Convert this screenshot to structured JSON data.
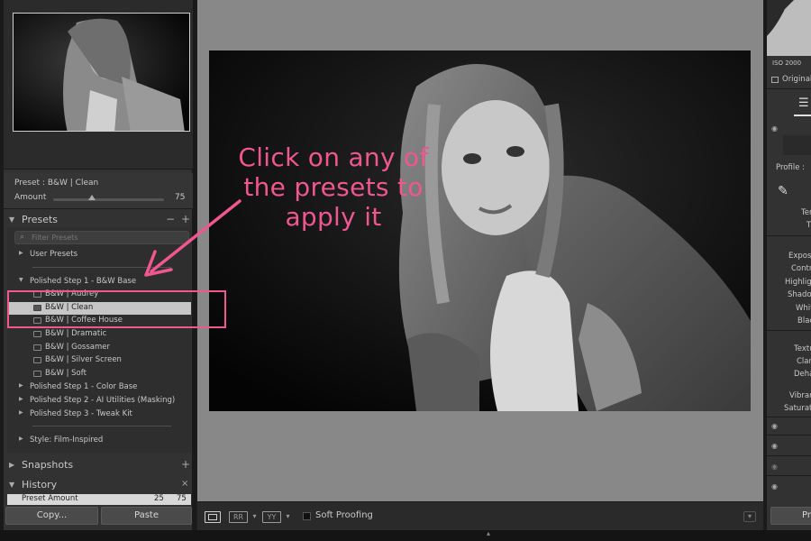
{
  "preset_info": {
    "preset_label": "Preset : B&W | Clean",
    "amount_label": "Amount",
    "amount_value": "75",
    "amount_fraction": 0.35
  },
  "presets_panel": {
    "title": "Presets",
    "minus": "−",
    "plus": "+",
    "filter_placeholder": "Filter Presets",
    "groups": [
      {
        "label": "User Presets"
      },
      {
        "label": "Polished Step 1 - B&W Base"
      }
    ],
    "items": [
      {
        "label": "B&W | Audrey"
      },
      {
        "label": "B&W | Clean"
      },
      {
        "label": "B&W | Coffee House"
      },
      {
        "label": "B&W | Dramatic"
      },
      {
        "label": "B&W | Gossamer"
      },
      {
        "label": "B&W | Silver Screen"
      },
      {
        "label": "B&W | Soft"
      }
    ],
    "more_groups": [
      {
        "label": "Polished Step 1 - Color Base"
      },
      {
        "label": "Polished Step 2 - AI Utilities (Masking)"
      },
      {
        "label": "Polished Step 3 - Tweak Kit"
      },
      {
        "label": "Style: Film-Inspired"
      }
    ]
  },
  "snapshots_panel": {
    "title": "Snapshots",
    "plus": "+"
  },
  "history_panel": {
    "title": "History",
    "close": "×",
    "row_label": "Preset Amount",
    "row_from": "25",
    "row_to": "75"
  },
  "buttons": {
    "copy": "Copy...",
    "paste": "Paste"
  },
  "toolbar": {
    "view_a": "RR",
    "view_b": "YY",
    "soft_proofing": "Soft Proofing"
  },
  "annotation": {
    "text": "Click on any of the presets to apply it",
    "color": "#f0568f"
  },
  "right_panel": {
    "iso": "ISO 2000",
    "original": "Original",
    "profile": "Profile :",
    "temp": "Ten",
    "tint": "Ti",
    "exposure": "Exposu",
    "contrast": "Contra",
    "highlights": "Highligh",
    "shadows": "Shadow",
    "whites": "Whit",
    "blacks": "Blac",
    "texture": "Textu",
    "clarity": "Clari",
    "dehaze": "Deha",
    "vibrance": "Vibran",
    "saturation": "Saturatio",
    "bottom_button": "Pr"
  }
}
